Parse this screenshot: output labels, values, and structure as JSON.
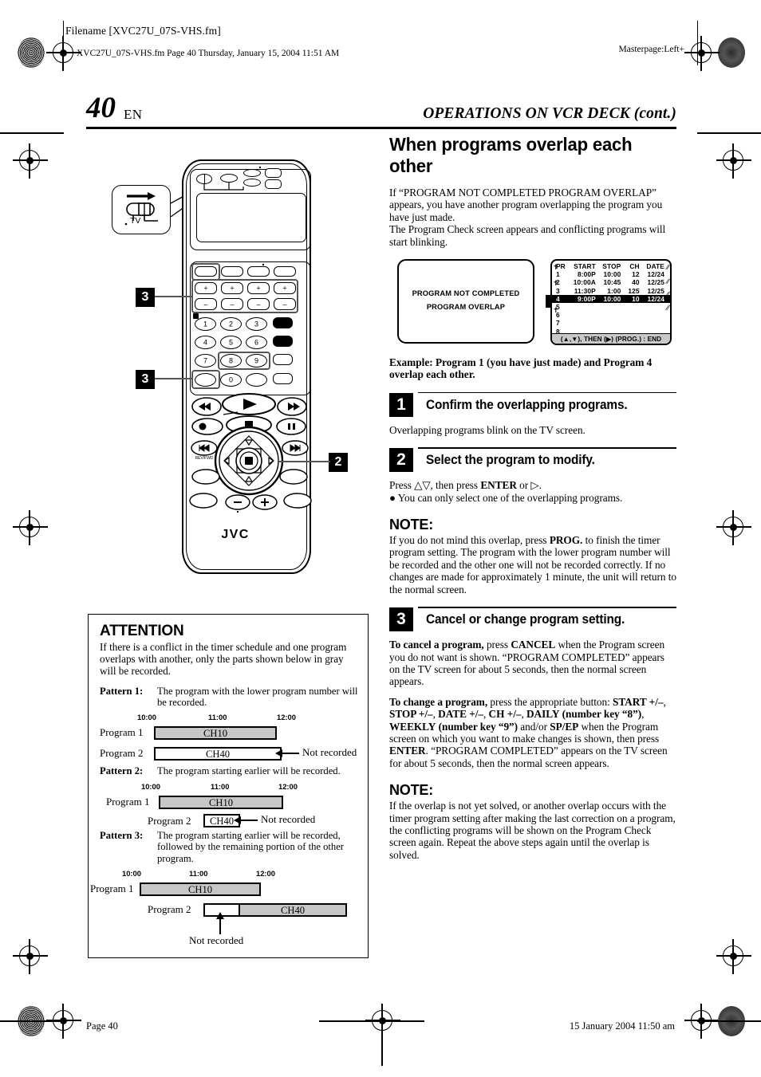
{
  "slug": {
    "filename": "Filename [XVC27U_07S-VHS.fm]",
    "line2": "XVC27U_07S-VHS.fm  Page 40  Thursday, January 15, 2004  11:51 AM",
    "masterpage": "Masterpage:Left+"
  },
  "header": {
    "page_number": "40",
    "language": "EN",
    "running_head": "OPERATIONS ON VCR DECK (cont.)"
  },
  "section": {
    "title": "When programs overlap each other",
    "intro_1": "If “PROGRAM NOT COMPLETED PROGRAM OVERLAP” appears, you have another program overlapping the program you have just made.",
    "intro_2": "The Program Check screen appears and conflicting programs will start blinking."
  },
  "tv_message": {
    "line1": "PROGRAM NOT COMPLETED",
    "line2": "PROGRAM OVERLAP"
  },
  "program_check": {
    "headers": [
      "PR",
      "START",
      "STOP",
      "CH",
      "DATE"
    ],
    "rows": [
      {
        "pr": "1",
        "start": "8:00P",
        "stop": "10:00",
        "ch": "12",
        "date": "12/24",
        "highlighted": false
      },
      {
        "pr": "2",
        "start": "10:00A",
        "stop": "10:45",
        "ch": "40",
        "date": "12/25",
        "highlighted": false
      },
      {
        "pr": "3",
        "start": "11:30P",
        "stop": "1:00",
        "ch": "125",
        "date": "12/25",
        "highlighted": false
      },
      {
        "pr": "4",
        "start": "9:00P",
        "stop": "10:00",
        "ch": "10",
        "date": "12/24",
        "highlighted": true
      },
      {
        "pr": "5",
        "start": "",
        "stop": "",
        "ch": "",
        "date": "",
        "highlighted": false
      },
      {
        "pr": "6",
        "start": "",
        "stop": "",
        "ch": "",
        "date": "",
        "highlighted": false
      },
      {
        "pr": "7",
        "start": "",
        "stop": "",
        "ch": "",
        "date": "",
        "highlighted": false
      },
      {
        "pr": "8",
        "start": "",
        "stop": "",
        "ch": "",
        "date": "",
        "highlighted": false
      }
    ],
    "footer": "(▲,▼), THEN (▶)  (PROG.) : END"
  },
  "example_note": "Example: Program 1 (you have just made) and Program 4 overlap each other.",
  "steps": [
    {
      "num": "1",
      "title": "Confirm the overlapping programs.",
      "body": "Overlapping programs blink on the TV screen."
    },
    {
      "num": "2",
      "title": "Select the program to modify.",
      "body_line1": "Press △▽, then press ENTER or ▷.",
      "body_bullet": "● You can only select one of the overlapping programs."
    },
    {
      "num": "3",
      "title": "Cancel or change program setting."
    }
  ],
  "note_1": {
    "heading": "NOTE:",
    "text": "If you do not mind this overlap, press PROG. to finish the timer program setting. The program with the lower program number will be recorded and the other one will not be recorded correctly. If no changes are made for approximately 1 minute, the unit will return to the normal screen."
  },
  "cancel_para": "To cancel a program, press CANCEL when the Program screen you do not want is shown. “PROGRAM COMPLETED” appears on the TV screen for about 5 seconds, then the normal screen appears.",
  "change_para": "To change a program, press the appropriate button: START +/–, STOP +/–, DATE +/–, CH +/–, DAILY (number key “8”), WEEKLY (number key “9”) and/or SP/EP when the Program screen on which you want to make changes is shown, then press ENTER. “PROGRAM COMPLETED” appears on the TV screen for about 5 seconds, then the normal screen appears.",
  "note_2": {
    "heading": "NOTE:",
    "text": "If the overlap is not yet solved, or another overlap occurs with the timer program setting after making the last correction on a program, the conflicting programs will be shown on the Program Check screen again. Repeat the above steps again until the overlap is solved."
  },
  "attention": {
    "title": "ATTENTION",
    "text": "If there is a conflict in the timer schedule and one program overlaps with another, only the parts shown below in gray will be recorded.",
    "patterns": [
      {
        "label": "Pattern 1:",
        "desc": "The program with the lower program number will be recorded.",
        "ticks": [
          "10:00",
          "11:00",
          "12:00"
        ],
        "rows": [
          {
            "label": "Program 1",
            "channel": "CH10",
            "recorded": "full"
          },
          {
            "label": "Program 2",
            "channel": "CH40",
            "recorded": "none"
          }
        ],
        "annotation": "Not recorded"
      },
      {
        "label": "Pattern 2:",
        "desc": "The program starting earlier will be recorded.",
        "ticks": [
          "10:00",
          "11:00",
          "12:00"
        ],
        "rows": [
          {
            "label": "Program 1",
            "channel": "CH10",
            "recorded": "full"
          },
          {
            "label": "Program 2",
            "channel": "CH40",
            "recorded": "none"
          }
        ],
        "annotation": "Not recorded"
      },
      {
        "label": "Pattern 3:",
        "desc": "The program starting earlier will be recorded, followed by the remaining portion of the other program.",
        "ticks": [
          "10:00",
          "11:00",
          "12:00"
        ],
        "rows": [
          {
            "label": "Program 1",
            "channel": "CH10",
            "recorded": "full"
          },
          {
            "label": "Program 2",
            "channel": "CH40",
            "recorded": "partial"
          }
        ],
        "annotation": "Not recorded"
      }
    ]
  },
  "remote": {
    "brand": "JVC",
    "tv_switch_label": "TV",
    "callouts": [
      "3",
      "3",
      "2"
    ],
    "number_keys": [
      "1",
      "2",
      "3",
      "4",
      "5",
      "6",
      "7",
      "8",
      "9",
      "0"
    ],
    "plus_minus": {
      "plus": "+",
      "minus": "–"
    }
  },
  "footer": {
    "left": "Page 40",
    "right": "15 January 2004 11:50 am"
  }
}
